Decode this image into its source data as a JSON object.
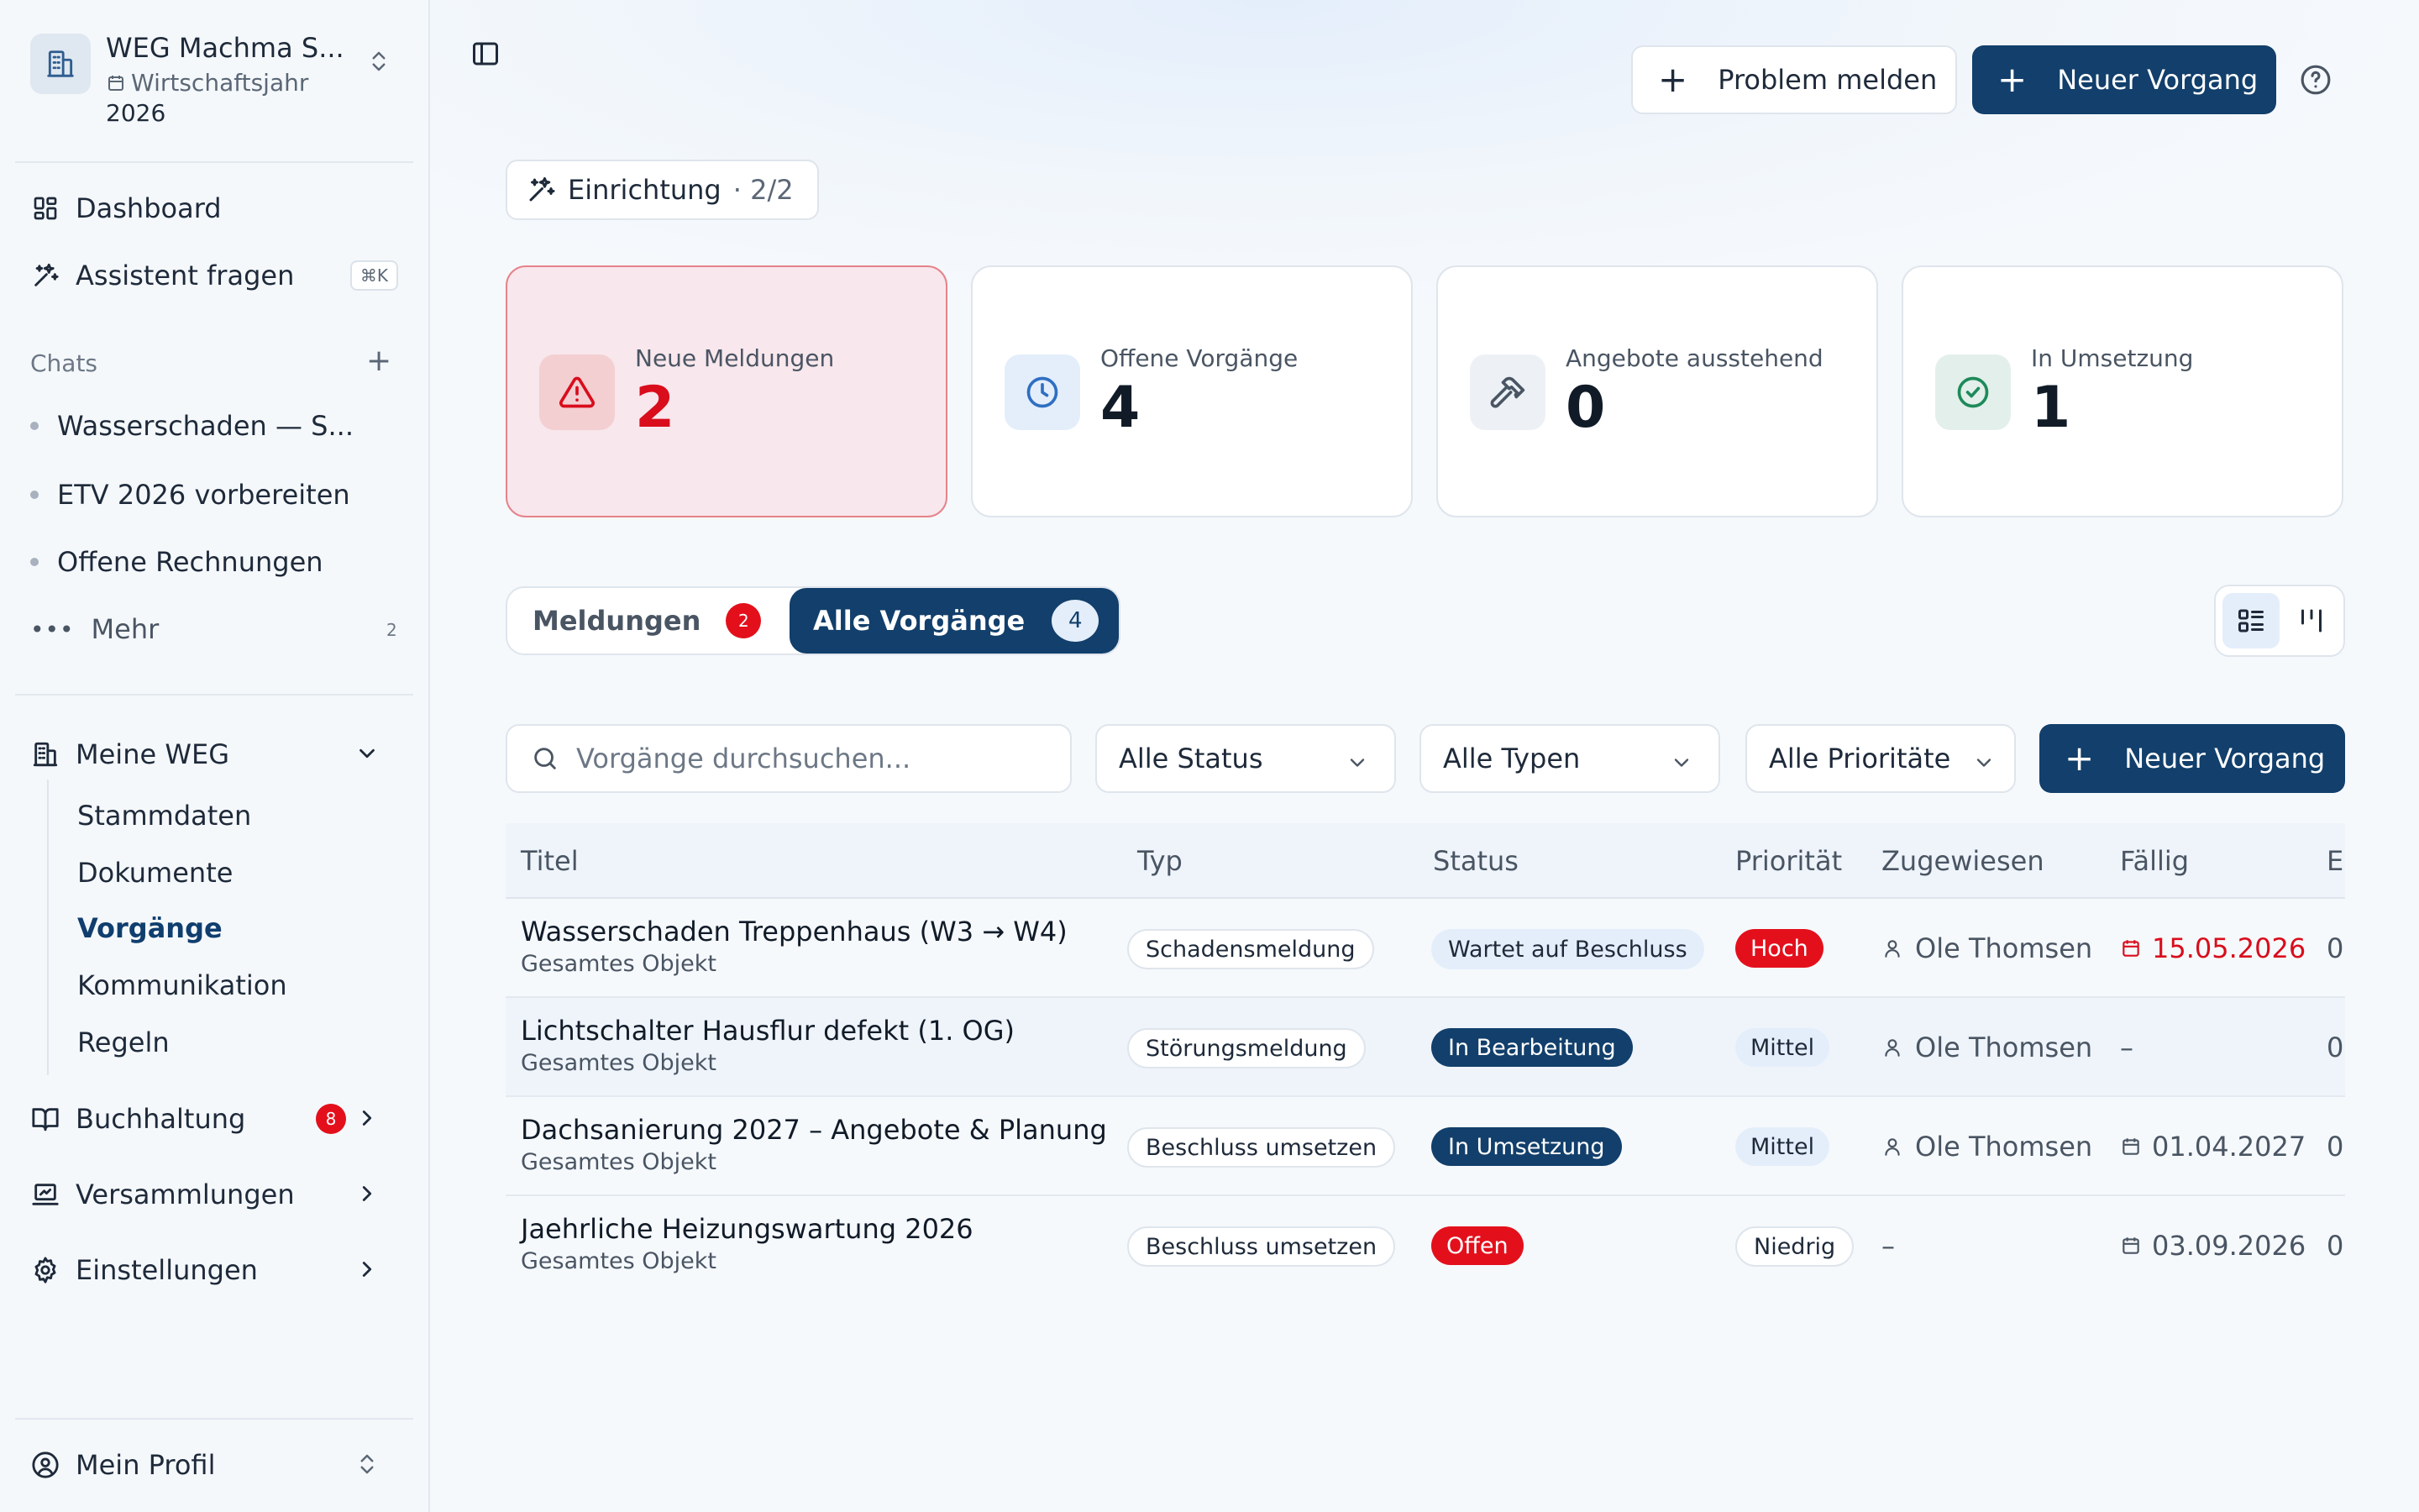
{
  "workspace": {
    "name": "WEG Machma S...",
    "fiscal_label": "Wirtschaftsjahr",
    "fiscal_year": "2026"
  },
  "nav": {
    "dashboard": "Dashboard",
    "assistant": "Assistent fragen",
    "assistant_shortcut": "⌘K"
  },
  "chats": {
    "label": "Chats",
    "items": [
      {
        "label": "Wasserschaden — S..."
      },
      {
        "label": "ETV 2026 vorbereiten"
      },
      {
        "label": "Offene Rechnungen"
      }
    ],
    "more_label": "Mehr",
    "more_count": "2"
  },
  "meine_weg": {
    "label": "Meine WEG",
    "items": [
      "Stammdaten",
      "Dokumente",
      "Vorgänge",
      "Kommunikation",
      "Regeln"
    ]
  },
  "sections": {
    "buchhaltung": "Buchhaltung",
    "buchhaltung_badge": "8",
    "versammlungen": "Versammlungen",
    "einstellungen": "Einstellungen",
    "profile": "Mein Profil"
  },
  "header": {
    "report_problem": "Problem melden",
    "new_case": "Neuer Vorgang"
  },
  "setup": {
    "label": "Einrichtung",
    "count": "· 2/2"
  },
  "stats": [
    {
      "label": "Neue Meldungen",
      "value": "2"
    },
    {
      "label": "Offene Vorgänge",
      "value": "4"
    },
    {
      "label": "Angebote ausstehend",
      "value": "0"
    },
    {
      "label": "In Umsetzung",
      "value": "1"
    }
  ],
  "tabs": {
    "reports": "Meldungen",
    "reports_count": "2",
    "all": "Alle Vorgänge",
    "all_count": "4"
  },
  "filters": {
    "search_placeholder": "Vorgänge durchsuchen...",
    "status": "Alle Status",
    "types": "Alle Typen",
    "priorities": "Alle Prioritäte",
    "new_case": "Neuer Vorgang"
  },
  "table": {
    "columns": [
      "Titel",
      "Typ",
      "Status",
      "Priorität",
      "Zugewiesen",
      "Fällig",
      "E"
    ],
    "rows": [
      {
        "title": "Wasserschaden Treppenhaus (W3 → W4)",
        "sub": "Gesamtes Objekt",
        "type": "Schadensmeldung",
        "status": "Wartet auf Beschluss",
        "priority": "Hoch",
        "assignee": "Ole Thomsen",
        "due": "15.05.2026",
        "extra": "0"
      },
      {
        "title": "Lichtschalter Hausflur defekt (1. OG)",
        "sub": "Gesamtes Objekt",
        "type": "Störungsmeldung",
        "status": "In Bearbeitung",
        "priority": "Mittel",
        "assignee": "Ole Thomsen",
        "due": "–",
        "extra": "0"
      },
      {
        "title": "Dachsanierung 2027 – Angebote & Planung",
        "sub": "Gesamtes Objekt",
        "type": "Beschluss umsetzen",
        "status": "In Umsetzung",
        "priority": "Mittel",
        "assignee": "Ole Thomsen",
        "due": "01.04.2027",
        "extra": "0"
      },
      {
        "title": "Jaehrliche Heizungswartung 2026",
        "sub": "Gesamtes Objekt",
        "type": "Beschluss umsetzen",
        "status": "Offen",
        "priority": "Niedrig",
        "assignee": "–",
        "due": "03.09.2026",
        "extra": "0"
      }
    ]
  },
  "colors": {
    "primary": "#123f6b",
    "danger": "#e3101c",
    "info_bg": "#e4eefb"
  }
}
